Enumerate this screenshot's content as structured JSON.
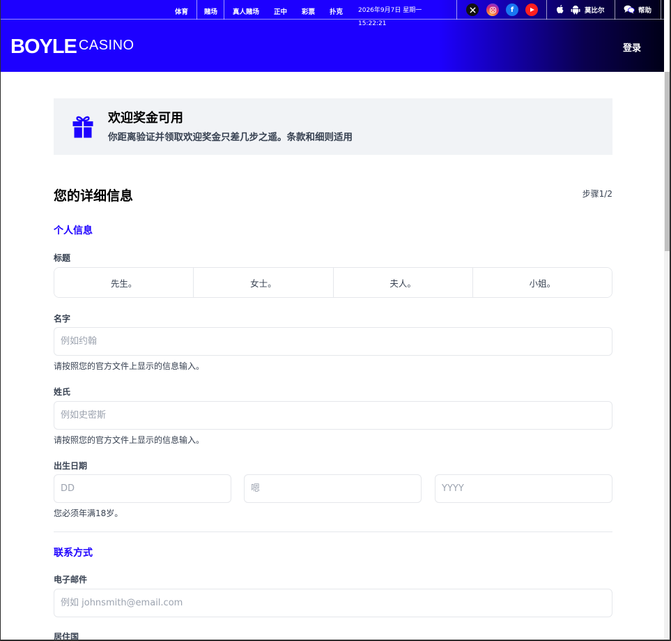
{
  "topbar": {
    "nav": [
      "体育",
      "赌场",
      "真人赌场",
      "正中",
      "彩票",
      "扑克"
    ],
    "datetime": "2026年9月7日 星期一 15:22:21",
    "mobile_label": "莫比尔",
    "help_label": "帮助"
  },
  "header": {
    "logo_main": "BOYLE",
    "logo_sub": "CASINO",
    "login": "登录"
  },
  "welcome": {
    "title": "欢迎奖金可用",
    "text": "你距离验证并领取欢迎奖金只差几步之遥。条款和细则适用"
  },
  "form": {
    "title": "您的详细信息",
    "step": "步骤1/2",
    "personal_section": "个人信息",
    "title_label": "标题",
    "title_options": [
      "先生。",
      "女士。",
      "夫人。",
      "小姐。"
    ],
    "first_name_label": "名字",
    "first_name_placeholder": "例如约翰",
    "first_name_hint": "请按照您的官方文件上显示的信息输入。",
    "last_name_label": "姓氏",
    "last_name_placeholder": "例如史密斯",
    "last_name_hint": "请按照您的官方文件上显示的信息输入。",
    "dob_label": "出生日期",
    "dob_day_placeholder": "DD",
    "dob_month_placeholder": "嗯",
    "dob_year_placeholder": "YYYY",
    "dob_hint": "您必须年满18岁。",
    "contact_section": "联系方式",
    "email_label": "电子邮件",
    "email_placeholder": "例如 johnsmith@email.com",
    "country_label": "居住国"
  },
  "colors": {
    "brand": "#1d00ff",
    "panel": "#f1f3f6",
    "border": "#e5e7eb"
  }
}
